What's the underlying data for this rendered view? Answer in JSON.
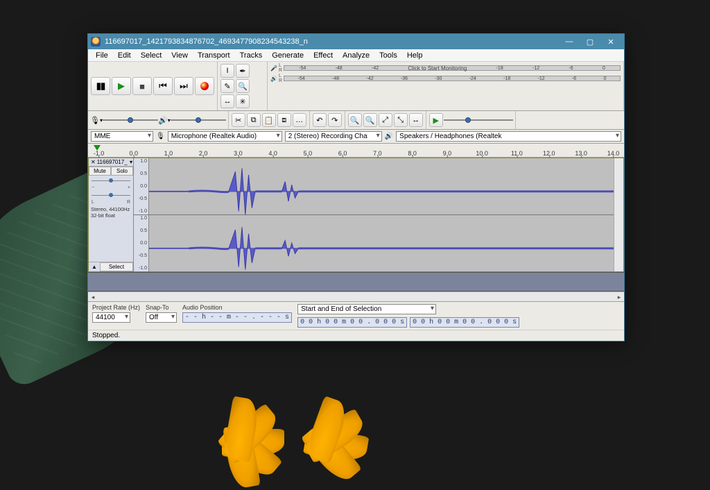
{
  "window": {
    "title": "116697017_1421793834876702_4693477908234543238_n",
    "min_tip": "Minimize",
    "max_tip": "Maximize",
    "close_tip": "Close"
  },
  "menu": [
    "File",
    "Edit",
    "Select",
    "View",
    "Transport",
    "Tracks",
    "Generate",
    "Effect",
    "Analyze",
    "Tools",
    "Help"
  ],
  "transport": {
    "pause": "⏸",
    "play": "▶",
    "stop": "■",
    "skip_start": "⏮",
    "skip_end": "⏭",
    "record": "●"
  },
  "tools": {
    "select": "I",
    "envelope": "✒",
    "draw": "✎",
    "zoom": "🔍",
    "timeshift": "↔",
    "multi": "✳"
  },
  "meter": {
    "rec_prompt": "Click to Start Monitoring",
    "ticks": [
      "-54",
      "-48",
      "-42",
      "-36",
      "-30",
      "-24",
      "-18",
      "-12",
      "-6",
      "0"
    ],
    "ticks_top": [
      "-54",
      "-48",
      "-42",
      "",
      "",
      "",
      "-18",
      "-12",
      "-6",
      "0"
    ]
  },
  "edit_tools": {
    "cut": "✂",
    "copy": "⧉",
    "paste": "📋",
    "trim": "⧈",
    "silence": "…",
    "undo": "↶",
    "redo": "↷",
    "zoom_in": "🔍+",
    "zoom_out": "🔍-",
    "zoom_sel": "⤢",
    "zoom_fit": "⤡",
    "zoom_toggle": "↔"
  },
  "device": {
    "host": "MME",
    "rec_device": "Microphone (Realtek Audio)",
    "channels": "2 (Stereo) Recording Cha",
    "play_device": "Speakers / Headphones (Realtek"
  },
  "timeline": {
    "marks": [
      {
        "pos": 2,
        "label": "-1.0"
      },
      {
        "pos": 8.5,
        "label": "0.0"
      },
      {
        "pos": 15,
        "label": "1.0"
      },
      {
        "pos": 21.5,
        "label": "2.0"
      },
      {
        "pos": 28,
        "label": "3.0"
      },
      {
        "pos": 34.5,
        "label": "4.0"
      },
      {
        "pos": 41,
        "label": "5.0"
      },
      {
        "pos": 47.5,
        "label": "6.0"
      },
      {
        "pos": 54,
        "label": "7.0"
      },
      {
        "pos": 60.5,
        "label": "8.0"
      },
      {
        "pos": 67,
        "label": "9.0"
      },
      {
        "pos": 73.5,
        "label": "10.0"
      },
      {
        "pos": 80,
        "label": "11.0"
      },
      {
        "pos": 86,
        "label": "12.0"
      },
      {
        "pos": 92,
        "label": "13.0"
      },
      {
        "pos": 98,
        "label": "14.0"
      }
    ]
  },
  "track": {
    "name": "116697017_",
    "mute": "Mute",
    "solo": "Solo",
    "l": "L",
    "r": "R",
    "info1": "Stereo, 44100Hz",
    "info2": "32-bit float",
    "select": "Select",
    "amp": [
      "1.0",
      "0.5",
      "0.0",
      "-0.5",
      "-1.0"
    ]
  },
  "selection": {
    "rate_label": "Project Rate (Hz)",
    "rate": "44100",
    "snap_label": "Snap-To",
    "snap": "Off",
    "pos_label": "Audio Position",
    "pos_val": "- - h - - m - - . - - - s",
    "range_label": "Start and End of Selection",
    "start": "0 0 h 0 0 m 0 0 . 0 0 0 s",
    "end": "0 0 h 0 0 m 0 0 . 0 0 0 s"
  },
  "status": "Stopped."
}
